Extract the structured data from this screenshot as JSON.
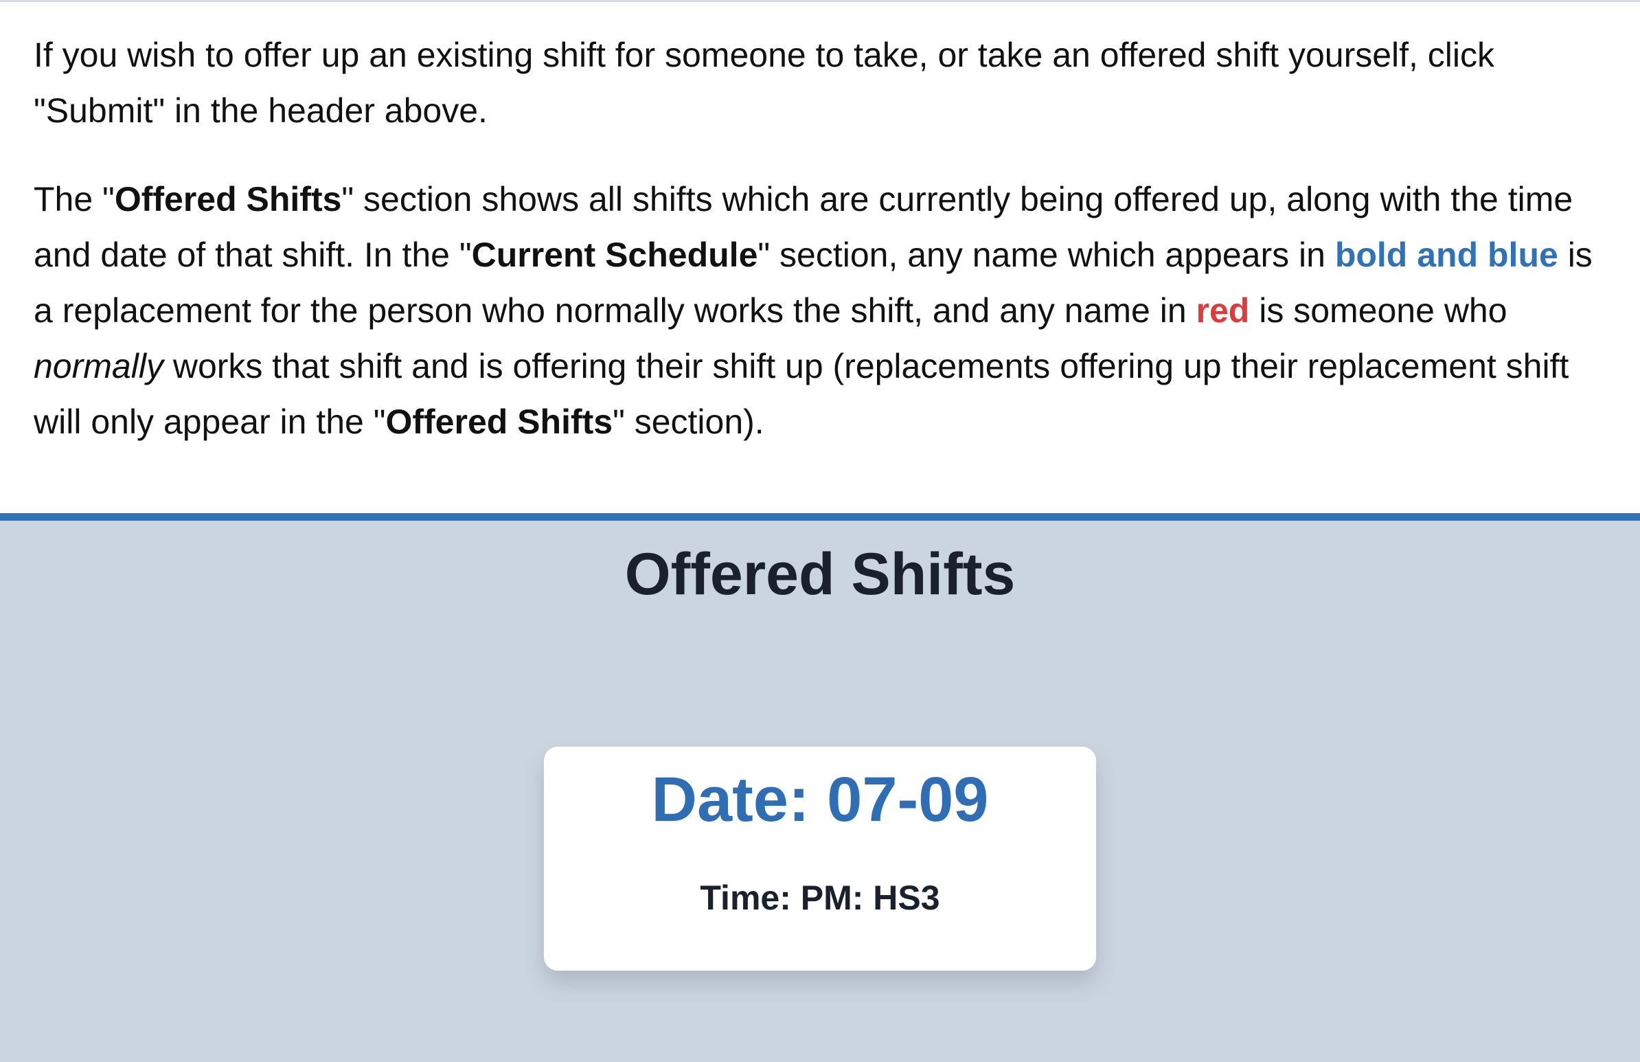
{
  "intro": {
    "paragraph_1": "If you wish to offer up an existing shift for someone to take, or take an offered shift yourself, click \"Submit\" in the header above.",
    "paragraph_2": {
      "text_1": "The \"",
      "offered_shifts_1": "Offered Shifts",
      "text_2": "\" section shows all shifts which are currently being offered up, along with the time and date of that shift. In the \"",
      "current_schedule": "Current Schedule",
      "text_3": "\" section, any name which appears in ",
      "bold_and_blue": "bold and blue",
      "text_4": " is a replacement for the person who normally works the shift, and any name in ",
      "red": "red",
      "text_5": " is someone who ",
      "normally": "normally",
      "text_6": " works that shift and is offering their shift up (replacements offering up their replacement shift will only appear in the \"",
      "offered_shifts_2": "Offered Shifts",
      "text_7": "\" section)."
    }
  },
  "offered_shifts": {
    "title": "Offered Shifts",
    "shifts": [
      {
        "date_label": "Date: 07-09",
        "time_label": "Time: PM: HS3"
      }
    ]
  },
  "colors": {
    "section_background": "#cbd5e0",
    "section_border": "#2f72b8",
    "replacement_blue": "#2f72b8",
    "offering_red": "#e03a3a",
    "date_blue": "#2f6eb5",
    "heading_text": "#1a202c"
  }
}
